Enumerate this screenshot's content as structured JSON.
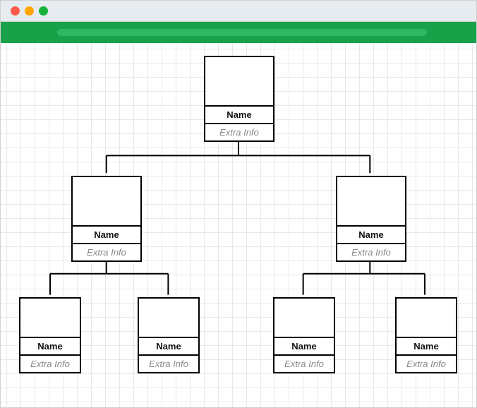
{
  "nodes": {
    "root": {
      "name": "Name",
      "extra": "Extra Info"
    },
    "l": {
      "name": "Name",
      "extra": "Extra Info"
    },
    "r": {
      "name": "Name",
      "extra": "Extra Info"
    },
    "ll": {
      "name": "Name",
      "extra": "Extra Info"
    },
    "lr": {
      "name": "Name",
      "extra": "Extra Info"
    },
    "rl": {
      "name": "Name",
      "extra": "Extra Info"
    },
    "rr": {
      "name": "Name",
      "extra": "Extra Info"
    }
  },
  "colors": {
    "ribbon": "#19a14a"
  }
}
